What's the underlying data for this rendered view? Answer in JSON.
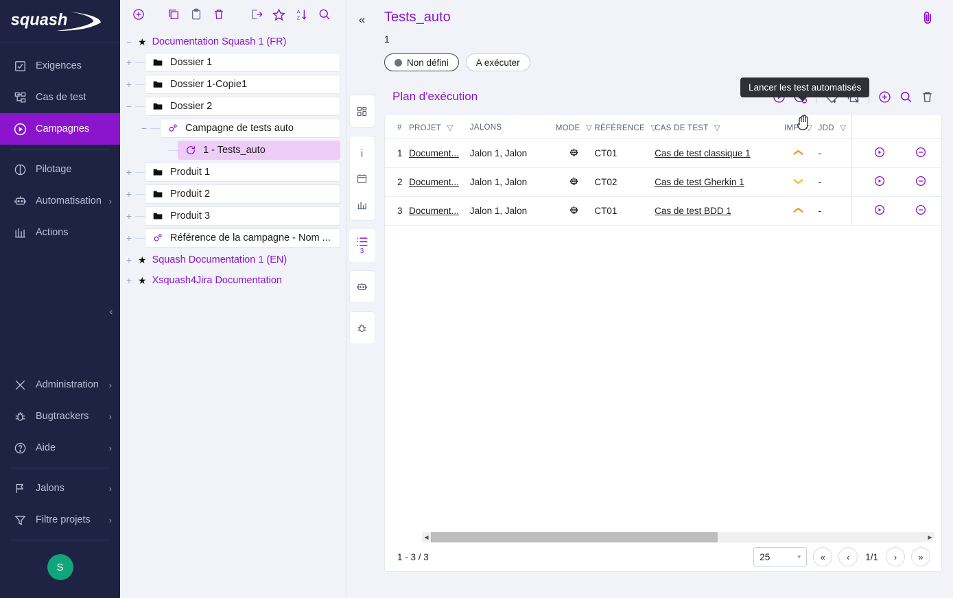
{
  "brand": {
    "name": "squash",
    "accent": "#8b15cc",
    "nav_bg": "#1e2344"
  },
  "sidebar": {
    "items": [
      {
        "label": "Exigences",
        "icon": "checklist-icon",
        "caret": "",
        "active": false
      },
      {
        "label": "Cas de test",
        "icon": "tree-nodes-icon",
        "caret": "",
        "active": false
      },
      {
        "label": "Campagnes",
        "icon": "play-circle-icon",
        "caret": "",
        "active": true
      },
      {
        "label": "Pilotage",
        "icon": "pie-chart-icon",
        "caret": "",
        "active": false
      },
      {
        "label": "Automatisation",
        "icon": "robot-icon",
        "caret": "›",
        "active": false
      },
      {
        "label": "Actions",
        "icon": "columns-icon",
        "caret": "",
        "active": false
      }
    ],
    "bottom_items": [
      {
        "label": "Administration",
        "icon": "tools-icon",
        "caret": "›"
      },
      {
        "label": "Bugtrackers",
        "icon": "bug-icon",
        "caret": "›"
      },
      {
        "label": "Aide",
        "icon": "help-circle-icon",
        "caret": "›"
      },
      {
        "label": "Jalons",
        "icon": "flag-icon",
        "caret": "›"
      },
      {
        "label": "Filtre projets",
        "icon": "funnel-icon",
        "caret": "›"
      }
    ],
    "avatar_initial": "S",
    "avatar_color": "#12a47a",
    "collapse_glyph": "‹"
  },
  "tree": {
    "toolbar": [
      "add-circle-icon",
      "copy-icon",
      "paste-icon",
      "delete-icon",
      "export-icon",
      "favorite-star-icon",
      "sort-az-icon",
      "search-icon"
    ],
    "roots": [
      {
        "label": "Documentation Squash 1 (FR)",
        "toggle": "−",
        "expanded": true,
        "children": [
          {
            "label": "Dossier 1",
            "icon": "folder-icon",
            "toggle": "+",
            "indent": 1,
            "selected": false
          },
          {
            "label": "Dossier 1-Copie1",
            "icon": "folder-icon",
            "toggle": "+",
            "indent": 1,
            "selected": false
          },
          {
            "label": "Dossier 2",
            "icon": "folder-icon",
            "toggle": "−",
            "indent": 1,
            "selected": false
          },
          {
            "label": "Campagne de tests auto",
            "icon": "campaign-gear-icon",
            "toggle": "−",
            "indent": 2,
            "selected": false
          },
          {
            "label": "1 - Tests_auto",
            "icon": "iteration-icon",
            "toggle": "",
            "indent": 3,
            "selected": true
          },
          {
            "label": "Produit 1",
            "icon": "folder-icon",
            "toggle": "+",
            "indent": 1,
            "selected": false
          },
          {
            "label": "Produit 2",
            "icon": "folder-icon",
            "toggle": "+",
            "indent": 1,
            "selected": false
          },
          {
            "label": "Produit 3",
            "icon": "folder-icon",
            "toggle": "+",
            "indent": 1,
            "selected": false
          },
          {
            "label": "Référence de la campagne - Nom ...",
            "icon": "campaign-gear-icon",
            "toggle": "+",
            "indent": 1,
            "selected": false
          }
        ]
      },
      {
        "label": "Squash Documentation 1 (EN)",
        "toggle": "+",
        "expanded": false,
        "children": []
      },
      {
        "label": "Xsquash4Jira Documentation",
        "toggle": "+",
        "expanded": false,
        "children": []
      }
    ]
  },
  "rail": {
    "collapse_glyph": "«",
    "groups": [
      {
        "buttons": [
          {
            "icon": "dashboard-icon",
            "count": "",
            "selected": false
          }
        ]
      },
      {
        "buttons": [
          {
            "icon": "info-icon",
            "count": "",
            "selected": false
          },
          {
            "icon": "calendar-icon",
            "count": "",
            "selected": false
          },
          {
            "icon": "bar-chart-icon",
            "count": "",
            "selected": false
          }
        ]
      },
      {
        "buttons": [
          {
            "icon": "execution-plan-list-icon",
            "count": "3",
            "selected": true
          }
        ]
      },
      {
        "buttons": [
          {
            "icon": "robot-icon",
            "count": "",
            "selected": false
          }
        ]
      },
      {
        "buttons": [
          {
            "icon": "bug-icon",
            "count": "",
            "selected": false
          }
        ]
      }
    ]
  },
  "main": {
    "title": "Tests_auto",
    "subtitle": "1",
    "attachment_icon": "paperclip-icon",
    "chips": [
      {
        "label": "Non défini",
        "has_dot": true
      },
      {
        "label": "A exécuter",
        "has_dot": false
      }
    ],
    "section_title": "Plan d'exécution",
    "tooltip": "Lancer les test automatisés",
    "tools": [
      {
        "icon": "run-icon",
        "style": "accent"
      },
      {
        "icon": "run-automated-icon",
        "style": "accent"
      },
      {
        "divider": true
      },
      {
        "icon": "tag-add-icon",
        "style": "grey"
      },
      {
        "icon": "duplicate-select-icon",
        "style": "grey"
      },
      {
        "divider": true
      },
      {
        "icon": "add-circle-icon",
        "style": "accent"
      },
      {
        "icon": "search-icon",
        "style": "accent"
      },
      {
        "icon": "delete-icon",
        "style": "grey"
      }
    ]
  },
  "table": {
    "columns": [
      {
        "key": "num",
        "label": "#",
        "filter": false
      },
      {
        "key": "proj",
        "label": "PROJET",
        "filter": true
      },
      {
        "key": "jal",
        "label": "JALONS",
        "filter": false
      },
      {
        "key": "mode",
        "label": "MODE",
        "filter": true
      },
      {
        "key": "ref",
        "label": "RÉFÉRENCE",
        "filter": true
      },
      {
        "key": "cdt",
        "label": "CAS DE TEST",
        "filter": true
      },
      {
        "key": "imp",
        "label": "IMP.",
        "filter": true
      },
      {
        "key": "jdd",
        "label": "JDD",
        "filter": true
      }
    ],
    "rows": [
      {
        "num": "1",
        "proj": "Document...",
        "jal": "Jalon 1, Jalon",
        "mode": "robot-icon",
        "ref": "CT01",
        "cdt": "Cas de test classique 1",
        "imp": "up",
        "jdd": "-",
        "actions": [
          "execute-icon",
          "remove-icon"
        ]
      },
      {
        "num": "2",
        "proj": "Document...",
        "jal": "Jalon 1, Jalon",
        "mode": "robot-icon",
        "ref": "CT02",
        "cdt": "Cas de test Gherkin 1",
        "imp": "down",
        "jdd": "-",
        "actions": [
          "execute-icon",
          "remove-icon"
        ]
      },
      {
        "num": "3",
        "proj": "Document...",
        "jal": "Jalon 1, Jalon",
        "mode": "robot-icon",
        "ref": "CT01",
        "cdt": "Cas de test BDD 1",
        "imp": "up",
        "jdd": "-",
        "actions": [
          "execute-icon",
          "remove-icon"
        ]
      }
    ],
    "footer": {
      "count_text": "1 - 3 / 3",
      "page_size": "25",
      "page_indicator": "1/1",
      "first_glyph": "«",
      "prev_glyph": "‹",
      "next_glyph": "›",
      "last_glyph": "»"
    }
  }
}
